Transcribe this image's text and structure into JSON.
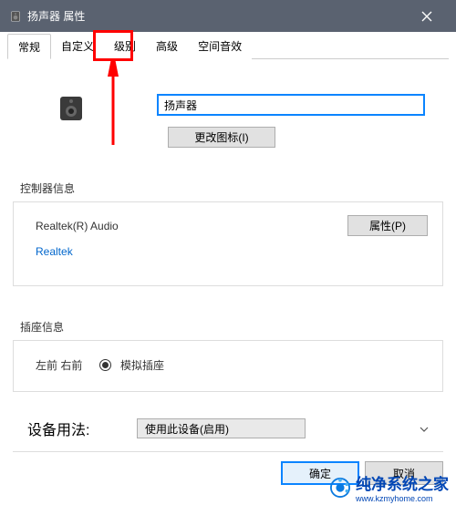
{
  "titlebar": {
    "title": "扬声器 属性"
  },
  "tabs": [
    "常规",
    "自定义",
    "级别",
    "高级",
    "空间音效"
  ],
  "device": {
    "name": "扬声器",
    "change_icon_btn": "更改图标(I)"
  },
  "controller": {
    "title": "控制器信息",
    "name": "Realtek(R) Audio",
    "vendor": "Realtek",
    "properties_btn": "属性(P)"
  },
  "jack": {
    "title": "插座信息",
    "label": "左前 右前",
    "radio_label": "模拟插座"
  },
  "usage": {
    "label": "设备用法:",
    "value": "使用此设备(启用)"
  },
  "buttons": {
    "ok": "确定",
    "cancel": "取消"
  },
  "watermark": {
    "text": "纯净系统之家",
    "url": "www.kzmyhome.com"
  }
}
